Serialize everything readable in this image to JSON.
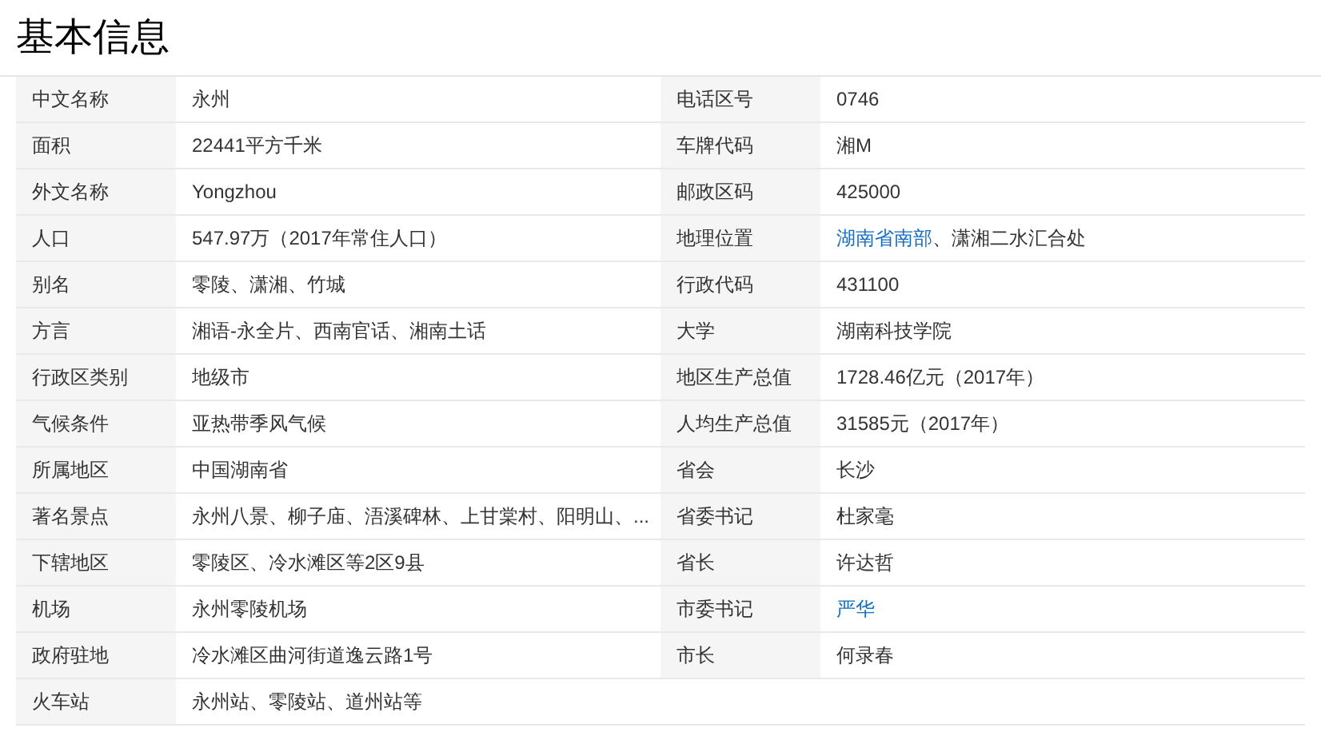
{
  "title": "基本信息",
  "rows": [
    {
      "left": {
        "label": "中文名称",
        "parts": [
          {
            "text": "永州",
            "kind": "plain"
          }
        ]
      },
      "right": {
        "label": "电话区号",
        "parts": [
          {
            "text": "0746",
            "kind": "plain"
          }
        ]
      }
    },
    {
      "left": {
        "label": "面积",
        "parts": [
          {
            "text": "22441平方千米",
            "kind": "plain"
          }
        ]
      },
      "right": {
        "label": "车牌代码",
        "parts": [
          {
            "text": "湘M",
            "kind": "plain"
          }
        ]
      }
    },
    {
      "left": {
        "label": "外文名称",
        "parts": [
          {
            "text": "Yongzhou",
            "kind": "plain"
          }
        ]
      },
      "right": {
        "label": "邮政区码",
        "parts": [
          {
            "text": "425000",
            "kind": "plain"
          }
        ]
      }
    },
    {
      "left": {
        "label": "人口",
        "parts": [
          {
            "text": "547.97万（2017年常住人口）",
            "kind": "plain"
          }
        ]
      },
      "right": {
        "label": "地理位置",
        "parts": [
          {
            "text": "湖南省南部",
            "kind": "link"
          },
          {
            "text": "、潇湘二水汇合处",
            "kind": "plain"
          }
        ]
      }
    },
    {
      "left": {
        "label": "别名",
        "parts": [
          {
            "text": "零陵、潇湘、竹城",
            "kind": "plain"
          }
        ]
      },
      "right": {
        "label": "行政代码",
        "parts": [
          {
            "text": "431100",
            "kind": "plain"
          }
        ]
      }
    },
    {
      "left": {
        "label": "方言",
        "parts": [
          {
            "text": "湘语-永全片、西南官话、湘南土话",
            "kind": "plain"
          }
        ]
      },
      "right": {
        "label": "大学",
        "parts": [
          {
            "text": "湖南科技学院",
            "kind": "plain"
          }
        ]
      }
    },
    {
      "left": {
        "label": "行政区类别",
        "parts": [
          {
            "text": "地级市",
            "kind": "plain"
          }
        ]
      },
      "right": {
        "label": "地区生产总值",
        "parts": [
          {
            "text": "1728.46亿元（2017年）",
            "kind": "plain"
          }
        ]
      }
    },
    {
      "left": {
        "label": "气候条件",
        "parts": [
          {
            "text": "亚热带季风气候",
            "kind": "plain"
          }
        ]
      },
      "right": {
        "label": "人均生产总值",
        "parts": [
          {
            "text": "31585元（2017年）",
            "kind": "plain"
          }
        ]
      }
    },
    {
      "left": {
        "label": "所属地区",
        "parts": [
          {
            "text": "中国湖南省",
            "kind": "plain"
          }
        ]
      },
      "right": {
        "label": "省会",
        "parts": [
          {
            "text": "长沙",
            "kind": "plain"
          }
        ]
      }
    },
    {
      "left": {
        "label": "著名景点",
        "parts": [
          {
            "text": "永州八景、柳子庙、浯溪碑林、上甘棠村、阳明山、...",
            "kind": "plain"
          }
        ]
      },
      "right": {
        "label": "省委书记",
        "parts": [
          {
            "text": "杜家毫",
            "kind": "plain"
          }
        ]
      }
    },
    {
      "left": {
        "label": "下辖地区",
        "parts": [
          {
            "text": "零陵区、冷水滩区等2区9县",
            "kind": "plain"
          }
        ]
      },
      "right": {
        "label": "省长",
        "parts": [
          {
            "text": "许达哲",
            "kind": "plain"
          }
        ]
      }
    },
    {
      "left": {
        "label": "机场",
        "parts": [
          {
            "text": "永州零陵机场",
            "kind": "plain"
          }
        ]
      },
      "right": {
        "label": "市委书记",
        "parts": [
          {
            "text": "严华",
            "kind": "link"
          }
        ]
      }
    },
    {
      "left": {
        "label": "政府驻地",
        "parts": [
          {
            "text": "冷水滩区曲河街道逸云路1号",
            "kind": "plain"
          }
        ]
      },
      "right": {
        "label": "市长",
        "parts": [
          {
            "text": "何录春",
            "kind": "plain"
          }
        ]
      }
    },
    {
      "left": {
        "label": "火车站",
        "parts": [
          {
            "text": "永州站、零陵站、道州站等",
            "kind": "plain"
          }
        ]
      }
    }
  ]
}
